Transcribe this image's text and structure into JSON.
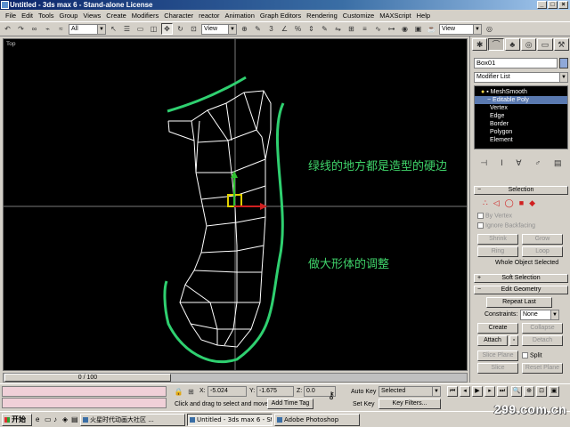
{
  "window": {
    "title": "Untitled - 3ds max 6 - Stand-alone License"
  },
  "menu": [
    "File",
    "Edit",
    "Tools",
    "Group",
    "Views",
    "Create",
    "Modifiers",
    "Character",
    "reactor",
    "Animation",
    "Graph Editors",
    "Rendering",
    "Customize",
    "MAXScript",
    "Help"
  ],
  "toolbar": {
    "selection_filter": "All",
    "ref_coord": "View",
    "named_set": "View"
  },
  "viewport": {
    "label": "Top",
    "annotation_1": "绿线的地方都是造型的硬边",
    "annotation_2": "做大形体的调整"
  },
  "timeline": {
    "frame": "0 / 100"
  },
  "command_panel": {
    "tabs": [
      "create-icon",
      "modify-icon",
      "hierarchy-icon",
      "motion-icon",
      "display-icon",
      "utilities-icon"
    ],
    "object_name": "Box01",
    "object_color": "#8fa8d8",
    "modifier_list": "Modifier List",
    "stack": [
      "MeshSmooth",
      "Editable Poly",
      "Vertex",
      "Edge",
      "Border",
      "Polygon",
      "Element"
    ],
    "selection_title": "Selection",
    "by_vertex": "By Vertex",
    "ignore_backfacing": "Ignore Backfacing",
    "shrink": "Shrink",
    "grow": "Grow",
    "ring": "Ring",
    "loop": "Loop",
    "whole_object": "Whole Object Selected",
    "soft_selection": "Soft Selection",
    "edit_geometry": "Edit Geometry",
    "repeat_last": "Repeat Last",
    "constraints_label": "Constraints:",
    "constraints_value": "None",
    "create": "Create",
    "collapse": "Collapse",
    "attach": "Attach",
    "detach": "Detach",
    "slice_plane": "Slice Plane",
    "split": "Split",
    "slice": "Slice",
    "reset_plane": "Reset Plane"
  },
  "status": {
    "x_label": "X:",
    "x_value": "-5.024",
    "y_label": "Y:",
    "y_value": "-1.675",
    "z_label": "Z:",
    "z_value": "0.0",
    "prompt": "Click and drag to select and move",
    "add_time_tag": "Add Time Tag",
    "auto_key": "Auto Key",
    "set_key": "Set Key",
    "key_mode": "Selected",
    "key_filters": "Key Filters..."
  },
  "taskbar": {
    "start": "开始",
    "items": [
      "火星时代动画大社区 ...",
      "Untitled - 3ds max 6 - Sta...",
      "Adobe Photoshop"
    ]
  },
  "watermark": "299.com.cn"
}
